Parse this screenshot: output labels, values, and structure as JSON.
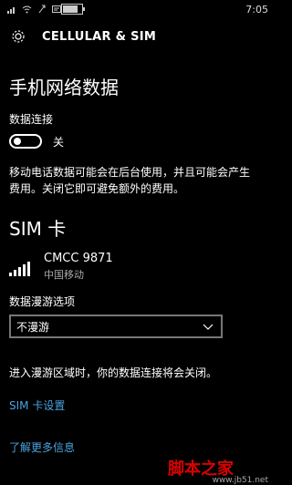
{
  "status_bar": {
    "time": "7:05",
    "battery_level": 0.8
  },
  "header": {
    "title": "CELLULAR & SIM"
  },
  "cellular": {
    "section_title": "手机网络数据",
    "data_connection_label": "数据连接",
    "toggle_state": "关",
    "description_line1": "移动电话数据可能会在后台使用，并且可能会产生",
    "description_line2": "费用。关闭它即可避免额外的费用。"
  },
  "sim": {
    "section_title": "SIM 卡",
    "name": "CMCC 9871",
    "carrier": "中国移动",
    "roaming_label": "数据漫游选项",
    "roaming_value": "不漫游",
    "roaming_note": "进入漫游区域时，你的数据连接将会关闭。",
    "settings_link": "SIM 卡设置"
  },
  "footer": {
    "learn_more": "了解更多信息"
  },
  "watermark": {
    "text": "脚本之家",
    "url": "www.jb51.net"
  }
}
